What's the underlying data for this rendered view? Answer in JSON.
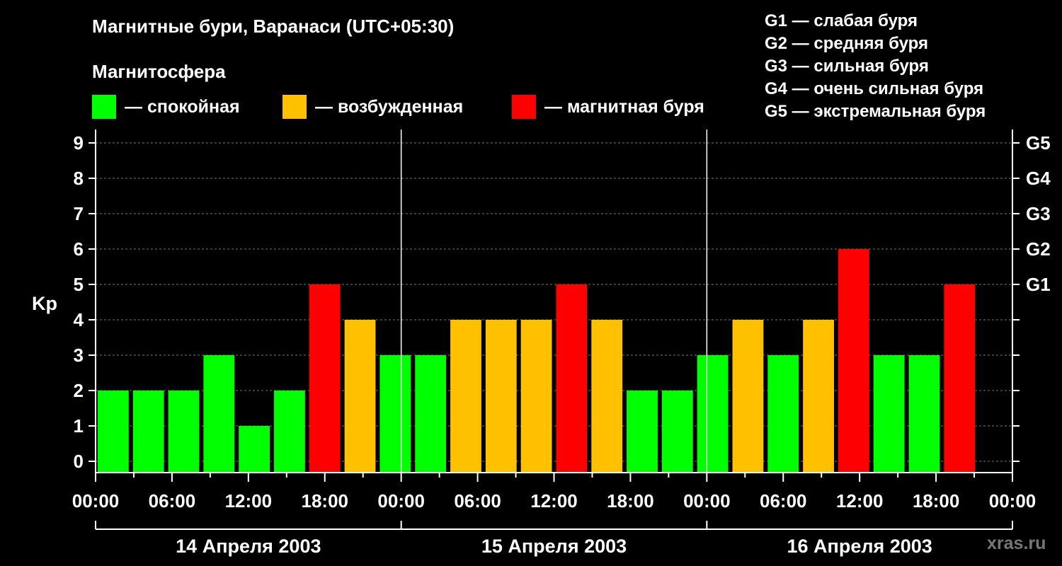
{
  "title": "Магнитные бури, Варанаси (UTC+05:30)",
  "legend": {
    "heading": "Магнитосфера",
    "items": [
      {
        "label": "— спокойная",
        "color": "#00ff00"
      },
      {
        "label": "— возбужденная",
        "color": "#ffc000"
      },
      {
        "label": "— магнитная буря",
        "color": "#ff0000"
      }
    ]
  },
  "g_legend": [
    "G1 — слабая буря",
    "G2 — средняя буря",
    "G3 — сильная буря",
    "G4 — очень сильная буря",
    "G5 — экстремальная буря"
  ],
  "brand": "xras.ru",
  "chart_data": {
    "type": "bar",
    "ylabel": "Kp",
    "ylim": [
      0,
      9
    ],
    "y_ticks": [
      "0",
      "1",
      "2",
      "3",
      "4",
      "5",
      "6",
      "7",
      "8",
      "9"
    ],
    "right_ticks": [
      {
        "label": "G1",
        "value": 5
      },
      {
        "label": "G2",
        "value": 6
      },
      {
        "label": "G3",
        "value": 7
      },
      {
        "label": "G4",
        "value": 8
      },
      {
        "label": "G5",
        "value": 9
      }
    ],
    "x_tick_labels": [
      "00:00",
      "06:00",
      "12:00",
      "18:00",
      "00:00",
      "06:00",
      "12:00",
      "18:00",
      "00:00",
      "06:00",
      "12:00",
      "18:00",
      "00:00"
    ],
    "days": [
      "14 Апреля 2003",
      "15 Апреля 2003",
      "16 Апреля 2003"
    ],
    "grid": "dashed horizontal",
    "values": [
      2,
      2,
      2,
      3,
      1,
      2,
      5,
      4,
      3,
      3,
      4,
      4,
      4,
      5,
      4,
      2,
      2,
      3,
      4,
      3,
      4,
      6,
      3,
      3,
      5
    ],
    "colors": {
      "quiet": "#00ff00",
      "active": "#ffc000",
      "storm": "#ff0000"
    }
  }
}
